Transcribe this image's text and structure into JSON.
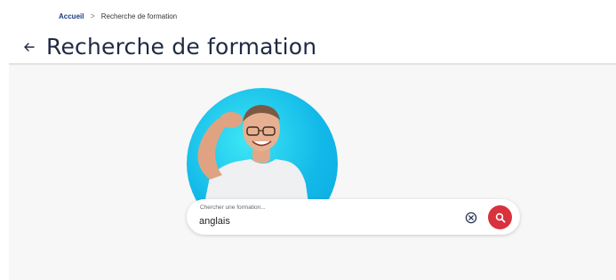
{
  "breadcrumb": {
    "home": "Accueil",
    "separator": ">",
    "current": "Recherche de formation"
  },
  "header": {
    "title": "Recherche de formation",
    "back_icon": "arrow-left-icon"
  },
  "search": {
    "label": "Chercher une formation...",
    "value": "anglais",
    "clear_icon": "clear-circle-icon",
    "submit_icon": "search-icon"
  },
  "colors": {
    "title": "#1f2a44",
    "breadcrumb_link": "#1a3a8a",
    "hero_circle": "#12b9e8",
    "search_button": "#d8323c",
    "background": "#f7f7f7"
  }
}
